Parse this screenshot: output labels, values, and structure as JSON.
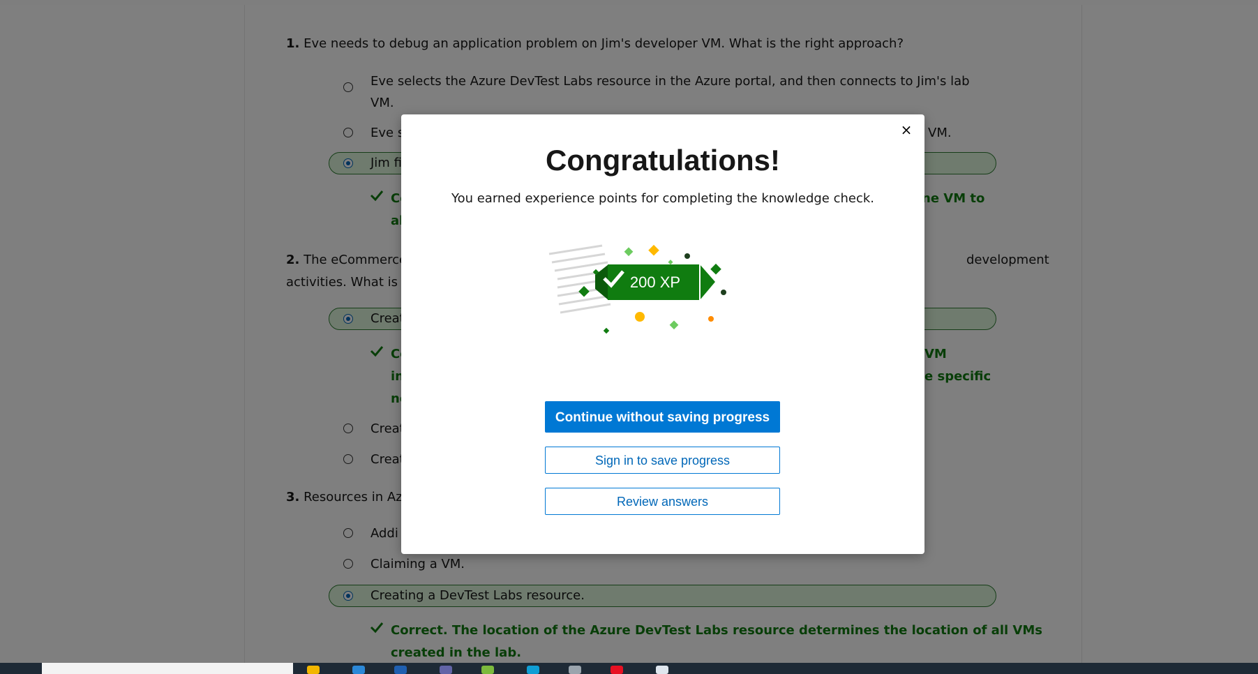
{
  "questions": [
    {
      "number": "1.",
      "text": "Eve needs to debug an application problem on Jim's developer VM. What is the right approach?",
      "options": [
        {
          "line1": "Eve selects the Azure DevTest Labs resource in the Azure portal, and then connects to Jim's lab",
          "line2": "VM."
        },
        {
          "left": "Eve s",
          "right": "VM."
        },
        {
          "left": "Jim fi"
        }
      ],
      "feedback": {
        "line1_left": "Co",
        "line1_right": "ne VM to",
        "line2_left": "al"
      }
    },
    {
      "number": "2.",
      "text_left": "The eCommerce",
      "text_right": "development",
      "text_line2": "activities. What is t",
      "options": [
        {
          "left": "Creat"
        },
        {
          "left": "Creat"
        },
        {
          "left": "Creat"
        }
      ],
      "feedback": {
        "line1_left": "Co",
        "line1_right": "VM",
        "line2_left": "in",
        "line2_right": "e specific",
        "line3_left": "ne"
      }
    },
    {
      "number": "3.",
      "text_left": "Resources in Azu",
      "options": [
        {
          "left": "Addi"
        },
        {
          "text": "Claiming a VM."
        },
        {
          "text": "Creating a DevTest Labs resource."
        }
      ],
      "feedback": {
        "line1": "Correct. The location of the Azure DevTest Labs resource determines the location of all VMs",
        "line2": "created in the lab."
      }
    }
  ],
  "modal": {
    "close_symbol": "×",
    "title": "Congratulations!",
    "subtitle": "You earned experience points for completing the knowledge check.",
    "xp_label": "200 XP",
    "continue_label": "Continue without saving progress",
    "signin_label": "Sign in to save progress",
    "review_label": "Review answers"
  },
  "colors": {
    "accent_blue": "#0078d4",
    "correct_green": "#107c10",
    "badge_green": "#107c10",
    "confetti_yellow": "#ffb900",
    "confetti_light_green": "#6ccb5f"
  },
  "icons": [
    "check-icon",
    "close-icon",
    "radio-icon",
    "xp-badge-icon"
  ]
}
